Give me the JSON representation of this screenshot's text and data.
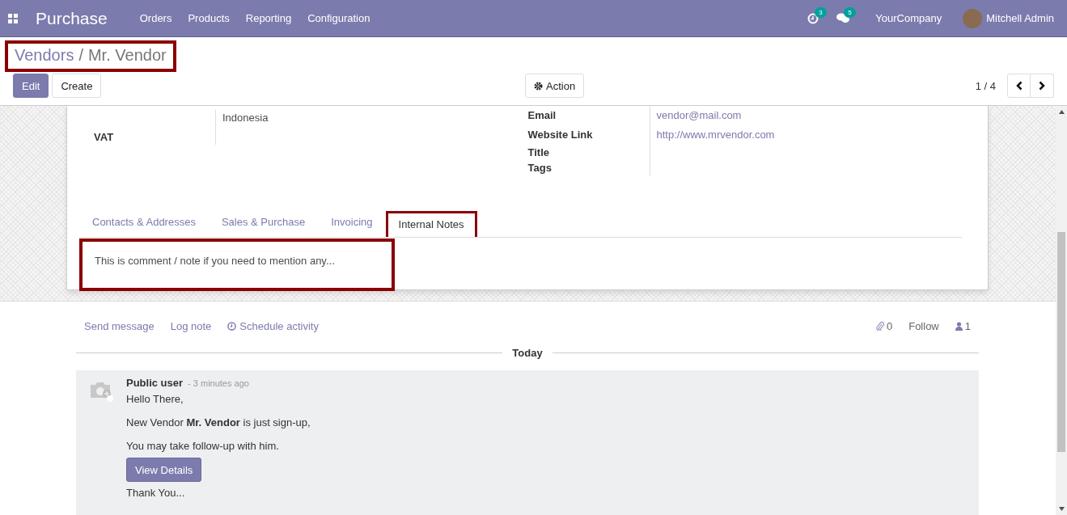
{
  "navbar": {
    "app_name": "Purchase",
    "menu": [
      "Orders",
      "Products",
      "Reporting",
      "Configuration"
    ],
    "activity_count": "3",
    "message_count": "5",
    "company": "YourCompany",
    "user": "Mitchell Admin"
  },
  "breadcrumb": {
    "parent": "Vendors",
    "separator": "/",
    "current": "Mr. Vendor",
    "highlighted": true
  },
  "buttons": {
    "edit": "Edit",
    "create": "Create",
    "action": "Action"
  },
  "pager": {
    "value": "1 / 4"
  },
  "form": {
    "left_fields": [
      {
        "value": "Indonesia"
      },
      {
        "label": "VAT"
      }
    ],
    "right_fields": [
      {
        "label": "Email",
        "value": "vendor@mail.com",
        "kind": "link"
      },
      {
        "label": "Website Link",
        "value": "http://www.mrvendor.com",
        "kind": "link"
      },
      {
        "label": "Title"
      },
      {
        "label": "Tags"
      }
    ],
    "tabs": [
      {
        "label": "Contacts & Addresses",
        "selected": false,
        "highlighted": false
      },
      {
        "label": "Sales & Purchase",
        "selected": false,
        "highlighted": false
      },
      {
        "label": "Invoicing",
        "selected": false,
        "highlighted": false
      },
      {
        "label": "Internal Notes",
        "selected": true,
        "highlighted": true
      }
    ],
    "note": {
      "text": "This is comment / note if you need to mention any...",
      "highlighted": true
    }
  },
  "chatter": {
    "actions": [
      "Send message",
      "Log note",
      "Schedule activity"
    ],
    "attachments": "0",
    "follow": "Follow",
    "followers": "1",
    "divider": "Today",
    "message": {
      "author": "Public user",
      "time": "- 3 minutes ago",
      "lines": [
        "Hello There,",
        "New Vendor **Mr. Vendor** is just sign-up,",
        "You may take follow-up with him."
      ],
      "button": "View Details",
      "closing": "Thank You..."
    }
  }
}
